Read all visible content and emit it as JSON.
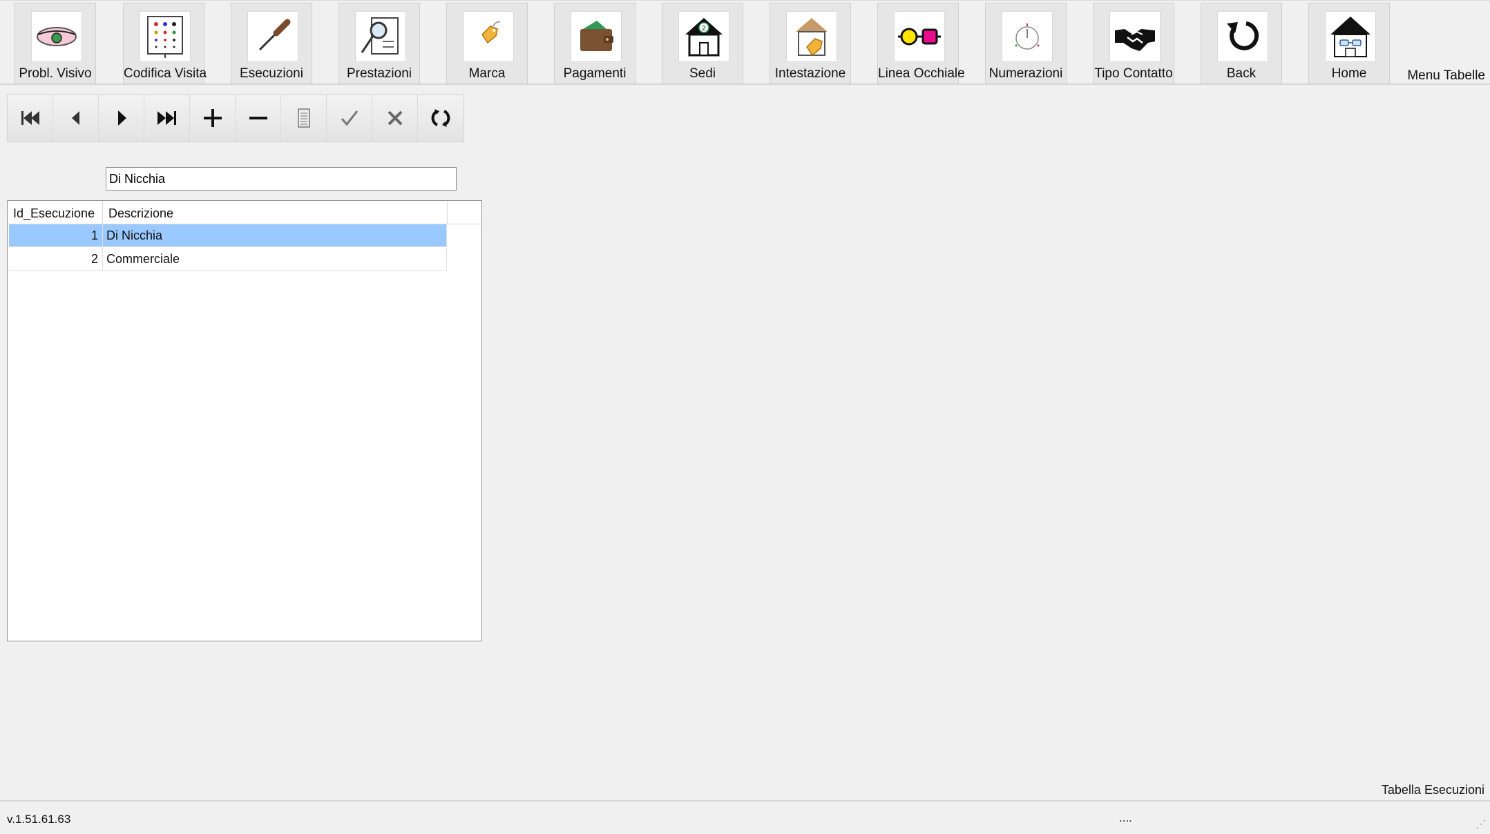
{
  "ribbon": {
    "tiles": [
      {
        "label": "Probl. Visivo",
        "icon": "eye-icon"
      },
      {
        "label": "Codifica Visita",
        "icon": "eye-chart-icon"
      },
      {
        "label": "Esecuzioni",
        "icon": "screwdriver-icon"
      },
      {
        "label": "Prestazioni",
        "icon": "magnifier-document-icon"
      },
      {
        "label": "Marca",
        "icon": "price-tag-icon"
      },
      {
        "label": "Pagamenti",
        "icon": "wallet-icon"
      },
      {
        "label": "Sedi",
        "icon": "house-number-icon"
      },
      {
        "label": "Intestazione",
        "icon": "house-tag-icon"
      },
      {
        "label": "Linea Occhiale",
        "icon": "glasses-line-icon"
      },
      {
        "label": "Numerazioni",
        "icon": "numbering-icon"
      },
      {
        "label": "Tipo Contatto",
        "icon": "handshake-icon"
      },
      {
        "label": "Back",
        "icon": "back-arrow-icon"
      },
      {
        "label": "Home",
        "icon": "home-icon"
      }
    ],
    "menu_title": "Menu Tabelle"
  },
  "navigator": [
    "first-record-icon",
    "previous-record-icon",
    "next-record-icon",
    "last-record-icon",
    "add-record-icon",
    "delete-record-icon",
    "edit-record-icon",
    "confirm-icon",
    "cancel-icon",
    "refresh-icon"
  ],
  "search": {
    "value": "Di Nicchia"
  },
  "grid": {
    "headers": {
      "id": "Id_Esecuzione",
      "desc": "Descrizione"
    },
    "rows": [
      {
        "id": "1",
        "desc": "Di Nicchia",
        "selected": true
      },
      {
        "id": "2",
        "desc": "Commerciale",
        "selected": false
      }
    ],
    "selection_color": "#99c9ff"
  },
  "footer": {
    "form_title": "Tabella Esecuzioni",
    "version": "v.1.51.61.63",
    "status": "...."
  }
}
